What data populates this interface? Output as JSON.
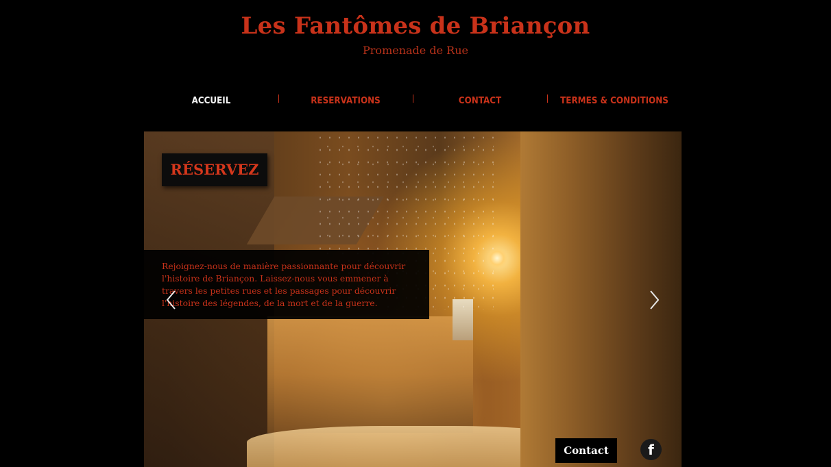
{
  "header": {
    "title": "Les Fantômes de Briançon",
    "subtitle": "Promenade de Rue"
  },
  "nav": {
    "items": [
      {
        "label": "ACCUEIL",
        "active": true
      },
      {
        "label": "RESERVATIONS",
        "active": false
      },
      {
        "label": "CONTACT",
        "active": false
      },
      {
        "label": "TERMES & CONDITIONS",
        "active": false
      }
    ]
  },
  "slideshow": {
    "reserve_label": "RÉSERVEZ",
    "description": "Rejoignez-nous de manière passionnante pour découvrir l'histoire de Briançon. Laissez-nous vous emmener à travers les petites rues et les passages pour découvrir l'histoire des légendes, de la mort et de la guerre.",
    "prev_icon": "chevron-left-icon",
    "next_icon": "chevron-right-icon"
  },
  "footer": {
    "contact_label": "Contact",
    "social_icon": "facebook-icon"
  },
  "colors": {
    "accent": "#c8321a",
    "background": "#000000",
    "active_nav": "#f4f4f4"
  }
}
